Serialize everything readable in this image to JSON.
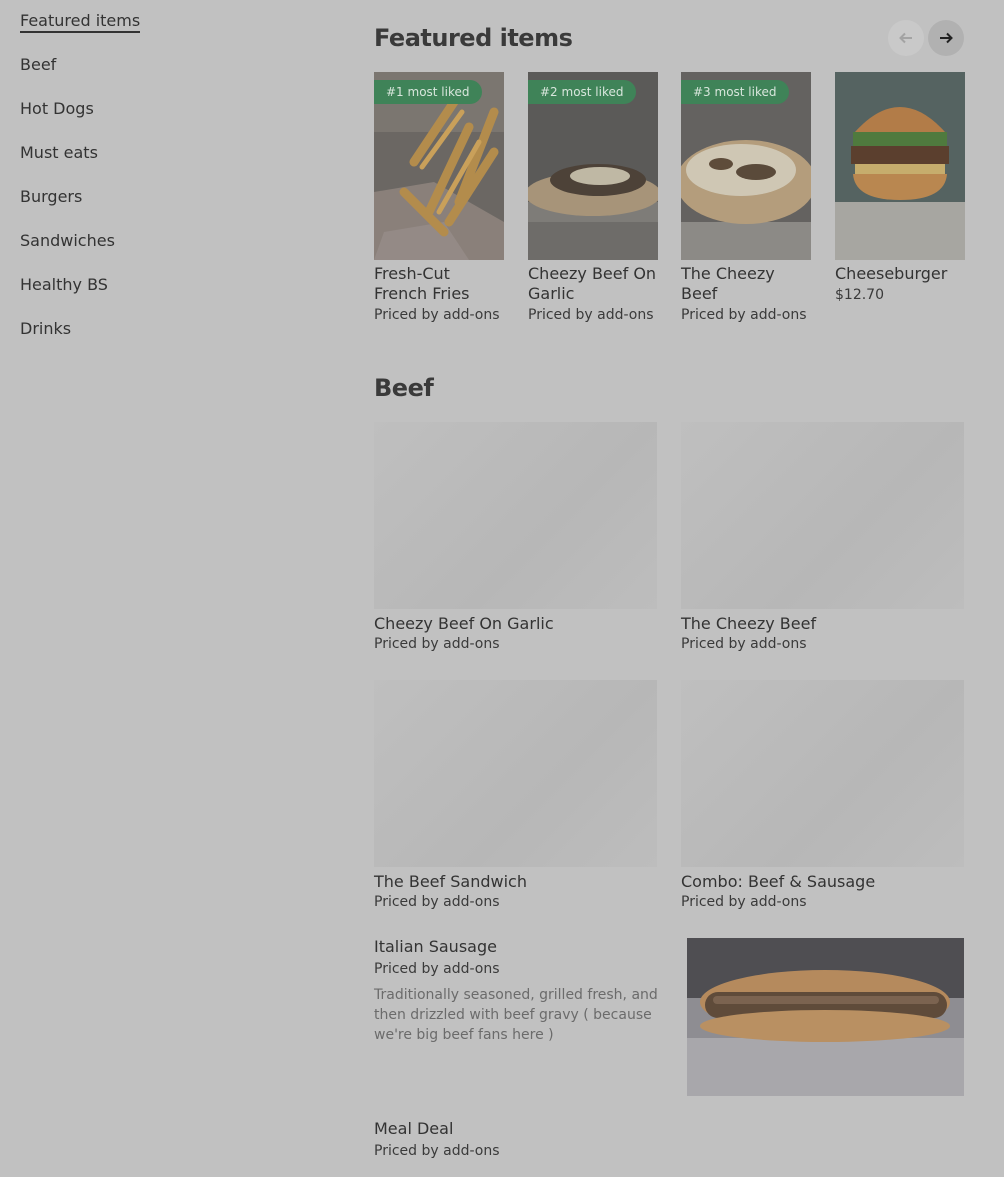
{
  "sidebar": {
    "items": [
      {
        "label": "Featured items"
      },
      {
        "label": "Beef"
      },
      {
        "label": "Hot Dogs"
      },
      {
        "label": "Must eats"
      },
      {
        "label": "Burgers"
      },
      {
        "label": "Sandwiches"
      },
      {
        "label": "Healthy BS"
      },
      {
        "label": "Drinks"
      }
    ]
  },
  "featured": {
    "title": "Featured items",
    "prev_icon": "arrow-left-icon",
    "next_icon": "arrow-right-icon",
    "cards": [
      {
        "badge": "#1 most liked",
        "title": "Fresh-Cut French Fries",
        "price": "Priced by add-ons"
      },
      {
        "badge": "#2 most liked",
        "title": "Cheezy Beef On Garlic",
        "price": "Priced by add-ons"
      },
      {
        "badge": "#3 most liked",
        "title": "The Cheezy Beef",
        "price": "Priced by add-ons"
      },
      {
        "badge": "",
        "title": "Cheeseburger",
        "price": "$12.70"
      }
    ]
  },
  "beef": {
    "title": "Beef",
    "grid": [
      {
        "title": "Cheezy Beef On Garlic",
        "price": "Priced by add-ons"
      },
      {
        "title": "The Cheezy Beef",
        "price": "Priced by add-ons"
      },
      {
        "title": "The Beef Sandwich",
        "price": "Priced by add-ons"
      },
      {
        "title": "Combo: Beef & Sausage",
        "price": "Priced by add-ons"
      }
    ],
    "italian": {
      "title": "Italian Sausage",
      "price": "Priced by add-ons",
      "description": "Traditionally seasoned, grilled fresh, and then drizzled with beef gravy ( because we're big beef fans here )"
    },
    "meal": {
      "title": "Meal Deal",
      "price": "Priced by add-ons"
    }
  }
}
